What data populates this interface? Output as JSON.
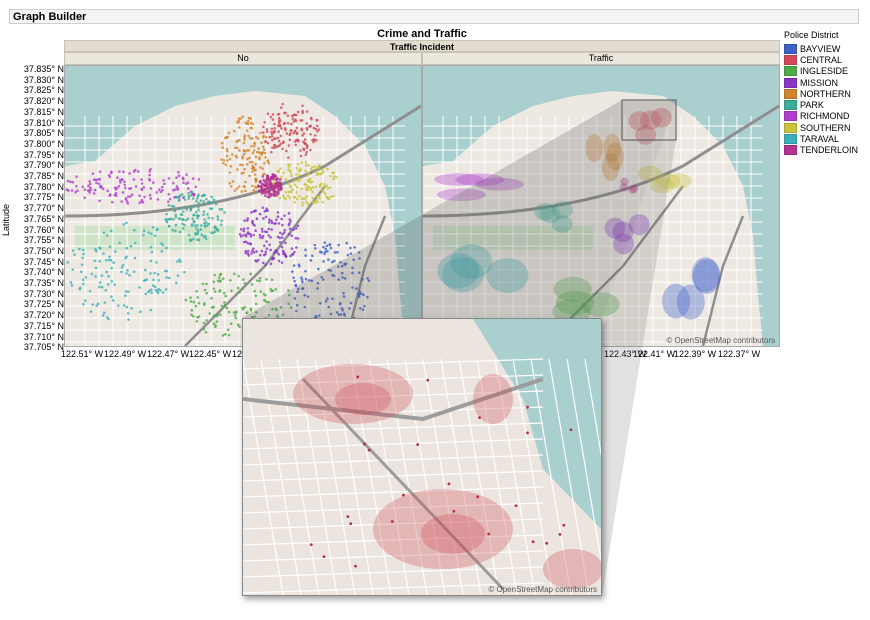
{
  "window": {
    "title": "Graph Builder"
  },
  "chart_data": {
    "type": "map",
    "title": "Crime and Traffic",
    "group_by": "Traffic Incident",
    "panels": [
      "No",
      "Traffic"
    ],
    "ylabel": "Latitude",
    "y_ticks": [
      "37.835° N",
      "37.830° N",
      "37.825° N",
      "37.820° N",
      "37.815° N",
      "37.810° N",
      "37.805° N",
      "37.800° N",
      "37.795° N",
      "37.790° N",
      "37.785° N",
      "37.780° N",
      "37.775° N",
      "37.770° N",
      "37.765° N",
      "37.760° N",
      "37.755° N",
      "37.750° N",
      "37.745° N",
      "37.740° N",
      "37.735° N",
      "37.730° N",
      "37.725° N",
      "37.720° N",
      "37.715° N",
      "37.710° N",
      "37.705° N"
    ],
    "x_ticks_left": [
      "122.51° W",
      "122.49° W",
      "122.47° W",
      "122.45° W",
      "122.4"
    ],
    "x_ticks_right": [
      "122.43° W",
      "122.41° W",
      "122.39° W",
      "122.37° W"
    ],
    "legend_title": "Police District",
    "legend": [
      {
        "name": "BAYVIEW",
        "color": "#3f5fc9"
      },
      {
        "name": "CENTRAL",
        "color": "#d24a5a"
      },
      {
        "name": "INGLESIDE",
        "color": "#4fab4a"
      },
      {
        "name": "MISSION",
        "color": "#8a35c8"
      },
      {
        "name": "NORTHERN",
        "color": "#d2852e"
      },
      {
        "name": "PARK",
        "color": "#3bae9a"
      },
      {
        "name": "RICHMOND",
        "color": "#b03fcf"
      },
      {
        "name": "SOUTHERN",
        "color": "#c9c33b"
      },
      {
        "name": "TARAVAL",
        "color": "#3bb0b8"
      },
      {
        "name": "TENDERLOIN",
        "color": "#b3338f"
      }
    ],
    "attribution": "© OpenStreetMap contributors"
  }
}
